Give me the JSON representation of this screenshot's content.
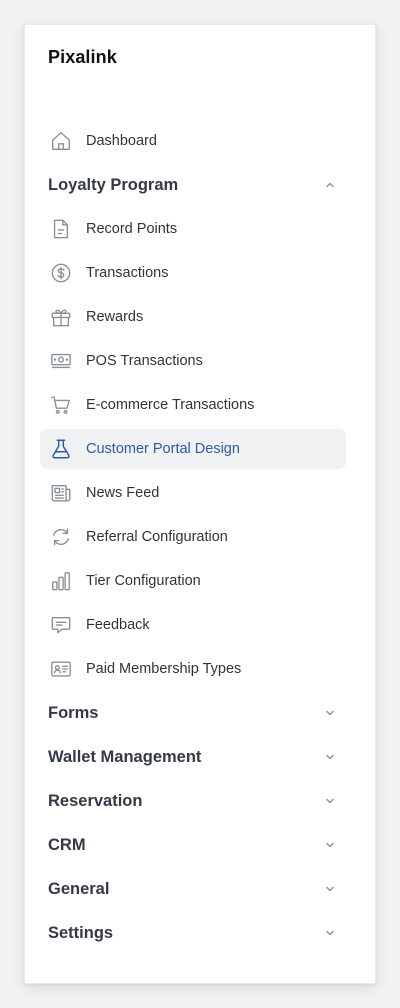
{
  "brand": {
    "name": "Pixalink"
  },
  "colors": {
    "active_text": "#2e5aa7",
    "active_bg": "#f0f1f3",
    "icon": "#8a9099",
    "icon_active": "#2e5aa7"
  },
  "nav": {
    "dashboard": {
      "label": "Dashboard",
      "icon": "home-icon"
    },
    "loyalty": {
      "label": "Loyalty Program",
      "expanded": true,
      "items": [
        {
          "label": "Record Points",
          "icon": "document-icon"
        },
        {
          "label": "Transactions",
          "icon": "dollar-circle-icon"
        },
        {
          "label": "Rewards",
          "icon": "gift-icon"
        },
        {
          "label": "POS Transactions",
          "icon": "cash-icon"
        },
        {
          "label": "E-commerce Transactions",
          "icon": "cart-icon"
        },
        {
          "label": "Customer Portal Design",
          "icon": "beaker-icon",
          "active": true
        },
        {
          "label": "News Feed",
          "icon": "newspaper-icon"
        },
        {
          "label": "Referral Configuration",
          "icon": "refresh-icon"
        },
        {
          "label": "Tier Configuration",
          "icon": "bar-chart-icon"
        },
        {
          "label": "Feedback",
          "icon": "chat-icon"
        },
        {
          "label": "Paid Membership Types",
          "icon": "id-card-icon"
        }
      ]
    },
    "sections": [
      {
        "label": "Forms",
        "expanded": false
      },
      {
        "label": "Wallet Management",
        "expanded": false
      },
      {
        "label": "Reservation",
        "expanded": false
      },
      {
        "label": "CRM",
        "expanded": false
      },
      {
        "label": "General",
        "expanded": false
      },
      {
        "label": "Settings",
        "expanded": false
      }
    ]
  }
}
